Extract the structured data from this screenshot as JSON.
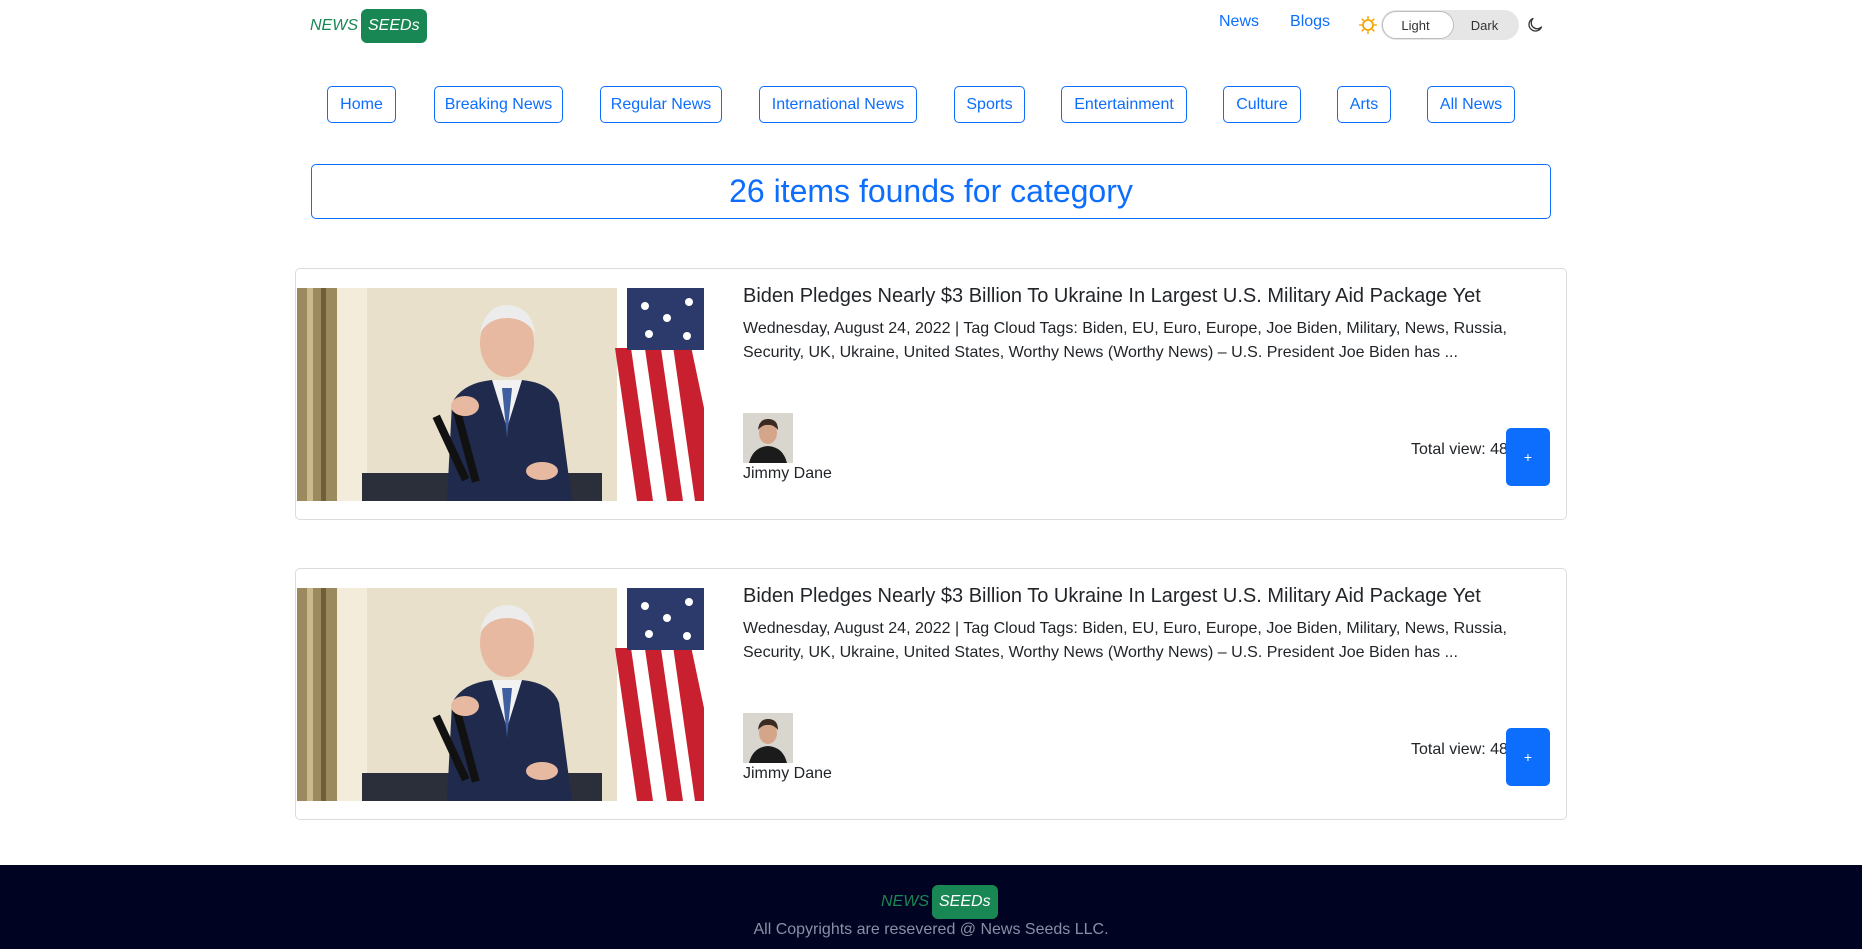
{
  "header": {
    "logo": {
      "news": "NEWS",
      "seeds": "SEEDs"
    },
    "links": [
      "News",
      "Blogs"
    ],
    "theme": {
      "light_label": "Light",
      "dark_label": "Dark",
      "selected": "Light",
      "sun_icon": "sun-icon",
      "moon_icon": "moon-icon"
    }
  },
  "nav": {
    "items": [
      "Home",
      "Breaking News",
      "Regular News",
      "International News",
      "Sports",
      "Entertainment",
      "Culture",
      "Arts",
      "All News"
    ]
  },
  "banner": {
    "text": "26 items founds for category"
  },
  "articles": [
    {
      "title": "Biden Pledges Nearly $3 Billion To Ukraine In Largest U.S. Military Aid Package Yet",
      "excerpt": "Wednesday, August 24, 2022 | Tag Cloud Tags: Biden, EU, Euro, Europe, Joe Biden, Military, News, Russia, Security, UK, Ukraine, United States, Worthy News (Worthy News) – U.S. President Joe Biden has ...",
      "author": "Jimmy Dane",
      "views": "Total view: 488",
      "button": "+"
    },
    {
      "title": "Biden Pledges Nearly $3 Billion To Ukraine In Largest U.S. Military Aid Package Yet",
      "excerpt": "Wednesday, August 24, 2022 | Tag Cloud Tags: Biden, EU, Euro, Europe, Joe Biden, Military, News, Russia, Security, UK, Ukraine, United States, Worthy News (Worthy News) – U.S. President Joe Biden has ...",
      "author": "Jimmy Dane",
      "views": "Total view: 488",
      "button": "+"
    }
  ],
  "footer": {
    "logo": {
      "news": "NEWS",
      "seeds": "SEEDs"
    },
    "copyright": "All Copyrights are resevered @ News Seeds LLC."
  },
  "colors": {
    "primary": "#0d6efd",
    "brand": "#198754",
    "footer_bg": "#010322"
  }
}
